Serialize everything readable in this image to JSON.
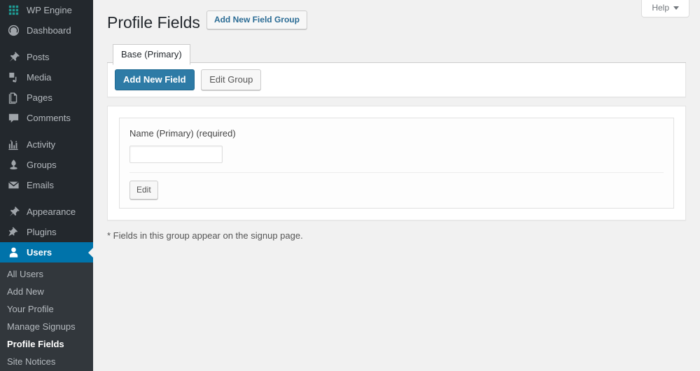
{
  "sidebar": {
    "items": [
      {
        "label": "WP Engine",
        "icon": "wpengine-grid-icon",
        "name": "sidebar-item-wp-engine",
        "current": false,
        "sep_after": false,
        "style": "wpengine"
      },
      {
        "label": "Dashboard",
        "icon": "dashboard-gauge-icon",
        "name": "sidebar-item-dashboard",
        "current": false,
        "sep_after": true
      },
      {
        "label": "Posts",
        "icon": "pin-icon",
        "name": "sidebar-item-posts",
        "current": false,
        "sep_after": false
      },
      {
        "label": "Media",
        "icon": "media-icon",
        "name": "sidebar-item-media",
        "current": false,
        "sep_after": false
      },
      {
        "label": "Pages",
        "icon": "pages-icon",
        "name": "sidebar-item-pages",
        "current": false,
        "sep_after": false
      },
      {
        "label": "Comments",
        "icon": "comment-bubble-icon",
        "name": "sidebar-item-comments",
        "current": false,
        "sep_after": true
      },
      {
        "label": "Activity",
        "icon": "activity-chart-icon",
        "name": "sidebar-item-activity",
        "current": false,
        "sep_after": false
      },
      {
        "label": "Groups",
        "icon": "groups-icon",
        "name": "sidebar-item-groups",
        "current": false,
        "sep_after": false
      },
      {
        "label": "Emails",
        "icon": "envelope-icon",
        "name": "sidebar-item-emails",
        "current": false,
        "sep_after": true
      },
      {
        "label": "Appearance",
        "icon": "paintbrush-icon",
        "name": "sidebar-item-appearance",
        "current": false,
        "sep_after": false
      },
      {
        "label": "Plugins",
        "icon": "plug-icon",
        "name": "sidebar-item-plugins",
        "current": false,
        "sep_after": false
      },
      {
        "label": "Users",
        "icon": "user-icon",
        "name": "sidebar-item-users",
        "current": true,
        "sep_after": false
      }
    ],
    "submenu": [
      {
        "label": "All Users",
        "name": "submenu-item-all-users",
        "current": false
      },
      {
        "label": "Add New",
        "name": "submenu-item-add-new",
        "current": false
      },
      {
        "label": "Your Profile",
        "name": "submenu-item-your-profile",
        "current": false
      },
      {
        "label": "Manage Signups",
        "name": "submenu-item-manage-signups",
        "current": false
      },
      {
        "label": "Profile Fields",
        "name": "submenu-item-profile-fields",
        "current": true
      },
      {
        "label": "Site Notices",
        "name": "submenu-item-site-notices",
        "current": false
      }
    ]
  },
  "screen_meta": {
    "help_label": "Help"
  },
  "header": {
    "title": "Profile Fields",
    "add_group_label": "Add New Field Group"
  },
  "tabs": [
    {
      "label": "Base (Primary)",
      "name": "tab-base-primary",
      "active": true
    }
  ],
  "actionbar": {
    "add_field_label": "Add New Field",
    "edit_group_label": "Edit Group"
  },
  "fields": [
    {
      "label": "Name (Primary) (required)",
      "value": "",
      "placeholder": "",
      "edit_label": "Edit"
    }
  ],
  "footnote": "* Fields in this group appear on the signup page.",
  "colors": {
    "sidebar_bg": "#23282d",
    "submenu_bg": "#32373c",
    "accent_blue": "#0073aa",
    "primary_button": "#2e7ba6",
    "link_blue": "#2a6b94",
    "page_bg": "#f1f1f1",
    "wpengine_teal": "#1f9a93"
  }
}
